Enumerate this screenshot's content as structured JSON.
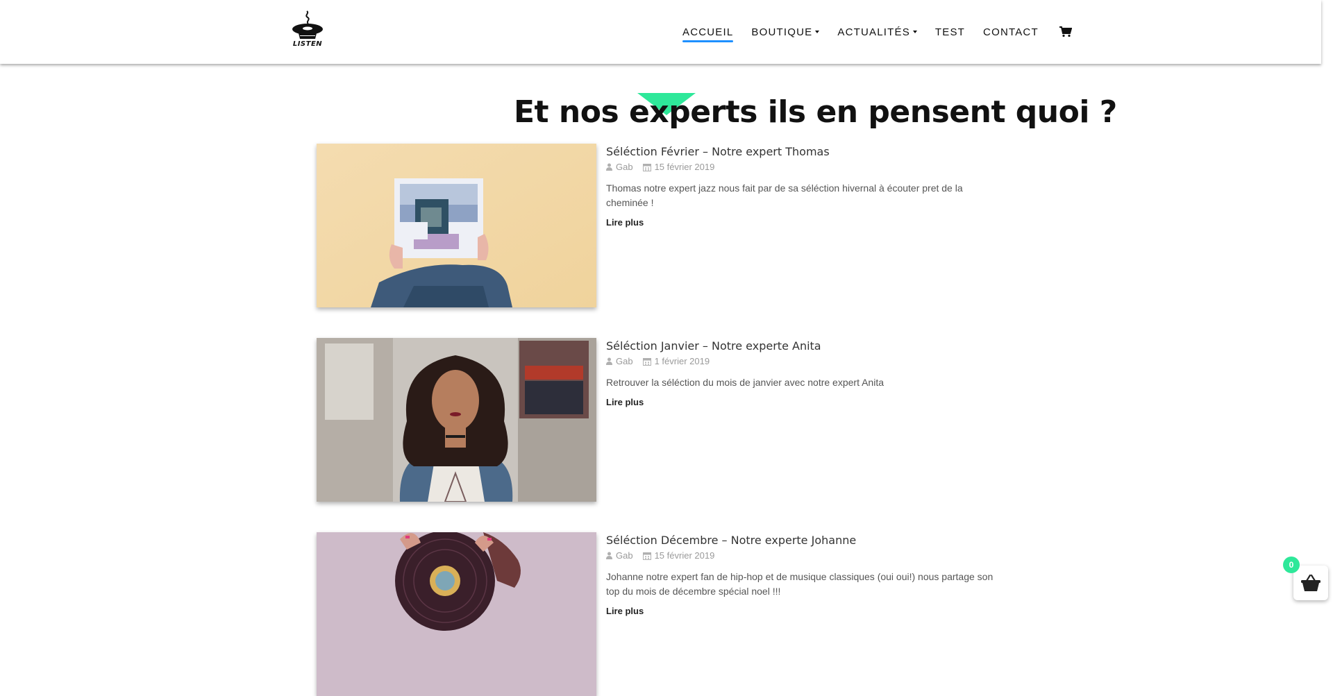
{
  "header": {
    "logo_text": "LISTEN",
    "nav": [
      {
        "label": "ACCUEIL",
        "active": true,
        "dropdown": false
      },
      {
        "label": "BOUTIQUE",
        "active": false,
        "dropdown": true
      },
      {
        "label": "ACTUALITÉS",
        "active": false,
        "dropdown": true
      },
      {
        "label": "TEST",
        "active": false,
        "dropdown": false
      },
      {
        "label": "CONTACT",
        "active": false,
        "dropdown": false
      }
    ],
    "cart_icon": "shopping-cart-icon",
    "accent_color": "#1e90ff"
  },
  "section": {
    "title": "Et nos experts ils en pensent quoi ?",
    "triangle_color": "#2ee89a"
  },
  "articles": [
    {
      "title": "Séléction Février – Notre expert Thomas",
      "author": "Gab",
      "date": "15 février 2019",
      "excerpt": "Thomas notre expert jazz nous fait par de sa séléction hivernal à écouter pret de la cheminée !",
      "read_more": "Lire plus"
    },
    {
      "title": "Séléction Janvier – Notre experte Anita",
      "author": "Gab",
      "date": "1 février 2019",
      "excerpt": "Retrouver la séléction du mois de janvier avec notre expert Anita",
      "read_more": "Lire plus"
    },
    {
      "title": "Séléction Décembre – Notre experte Johanne",
      "author": "Gab",
      "date": "15 février 2019",
      "excerpt": "Johanne notre expert fan de hip-hop et de musique classiques (oui oui!) nous partage son top du mois de décembre spécial noel !!!",
      "read_more": "Lire plus"
    }
  ],
  "floating_cart": {
    "count": "0",
    "icon": "basket-icon",
    "badge_color": "#2ee89a"
  }
}
